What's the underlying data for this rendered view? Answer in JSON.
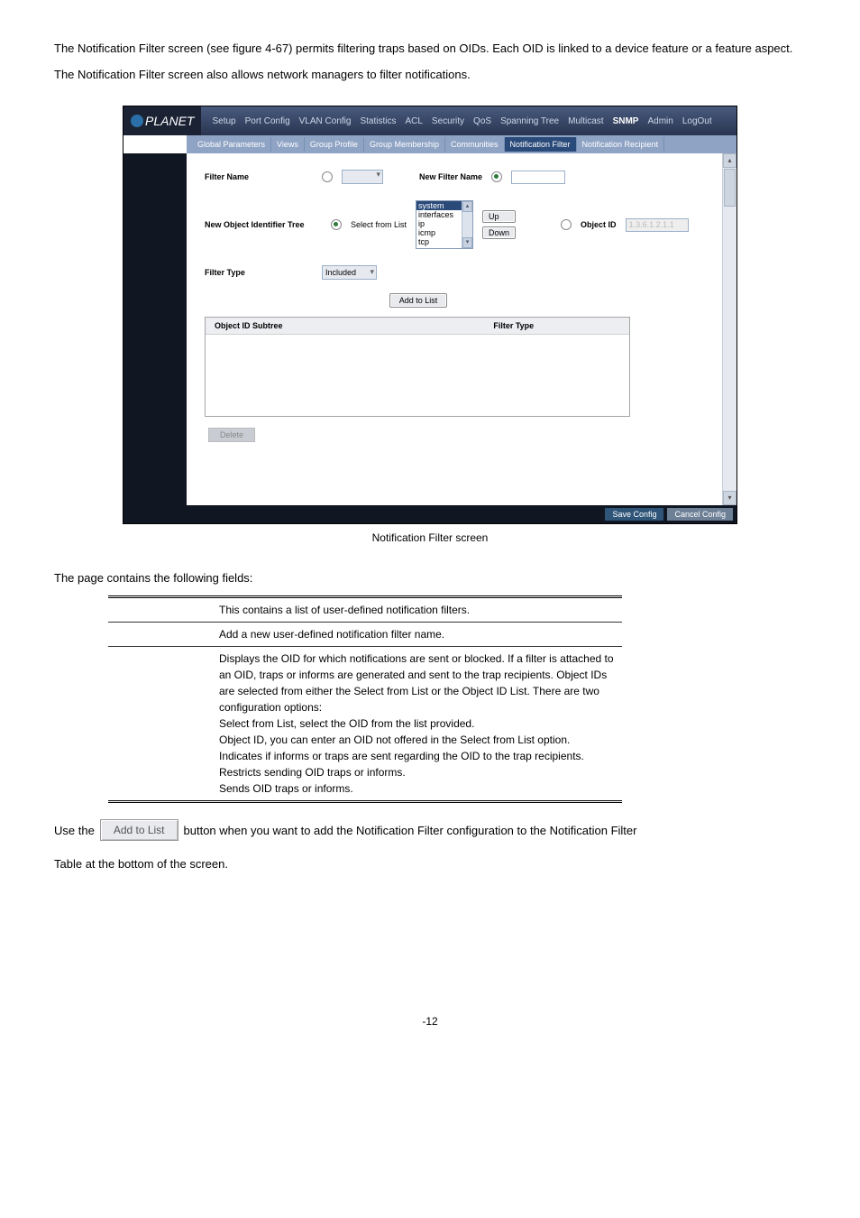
{
  "intro": "The Notification Filter screen (see figure 4-67) permits filtering traps based on OIDs. Each OID is linked to a device feature or a feature aspect. The Notification Filter screen also allows network managers to filter notifications.",
  "logo_text": "PLANET",
  "topnav": [
    "Setup",
    "Port Config",
    "VLAN Config",
    "Statistics",
    "ACL",
    "Security",
    "QoS",
    "Spanning Tree",
    "Multicast",
    "SNMP",
    "Admin",
    "LogOut"
  ],
  "topnav_active": "SNMP",
  "subnav": [
    "Global Parameters",
    "Views",
    "Group Profile",
    "Group Membership",
    "Communities",
    "Notification Filter",
    "Notification Recipient"
  ],
  "subnav_active": "Notification Filter",
  "form": {
    "filter_name_label": "Filter Name",
    "new_filter_name_label": "New Filter Name",
    "new_oid_label": "New Object Identifier Tree",
    "select_from_list_label": "Select from List",
    "listbox_items": [
      "system",
      "interfaces",
      "ip",
      "icmp",
      "tcp"
    ],
    "listbox_selected": "system",
    "up_label": "Up",
    "down_label": "Down",
    "object_id_label": "Object ID",
    "object_id_placeholder": "1.3.6.1.2.1.1",
    "filter_type_label": "Filter Type",
    "filter_type_value": "Included",
    "add_to_list_label": "Add to List",
    "table_col1": "Object ID Subtree",
    "table_col2": "Filter Type",
    "delete_label": "Delete",
    "save_label": "Save Config",
    "cancel_label": "Cancel Config"
  },
  "caption": "Notification Filter screen",
  "fields_intro": "The page contains the following fields:",
  "field_rows": {
    "r1": "This contains a list of user-defined notification filters.",
    "r2": "Add a new user-defined notification filter name.",
    "r3": "Displays the OID for which notifications are sent or blocked. If a filter is attached to an OID, traps or informs are generated and sent to the trap recipients. Object IDs are selected from either the Select from List or the Object ID List. There are two configuration options:\nSelect from List, select the OID from the list provided.\nObject ID, you can enter an OID not offered in the Select from List option.\nIndicates if informs or traps are sent regarding the OID to the trap recipients.\nRestricts sending OID traps or informs.\nSends OID traps or informs."
  },
  "addline_prefix": "Use the",
  "addline_button": "Add to List",
  "addline_suffix": "button when you want to add the Notification Filter configuration to the Notification Filter",
  "tabletext": "Table at the bottom of the screen.",
  "pagenum": "-12"
}
